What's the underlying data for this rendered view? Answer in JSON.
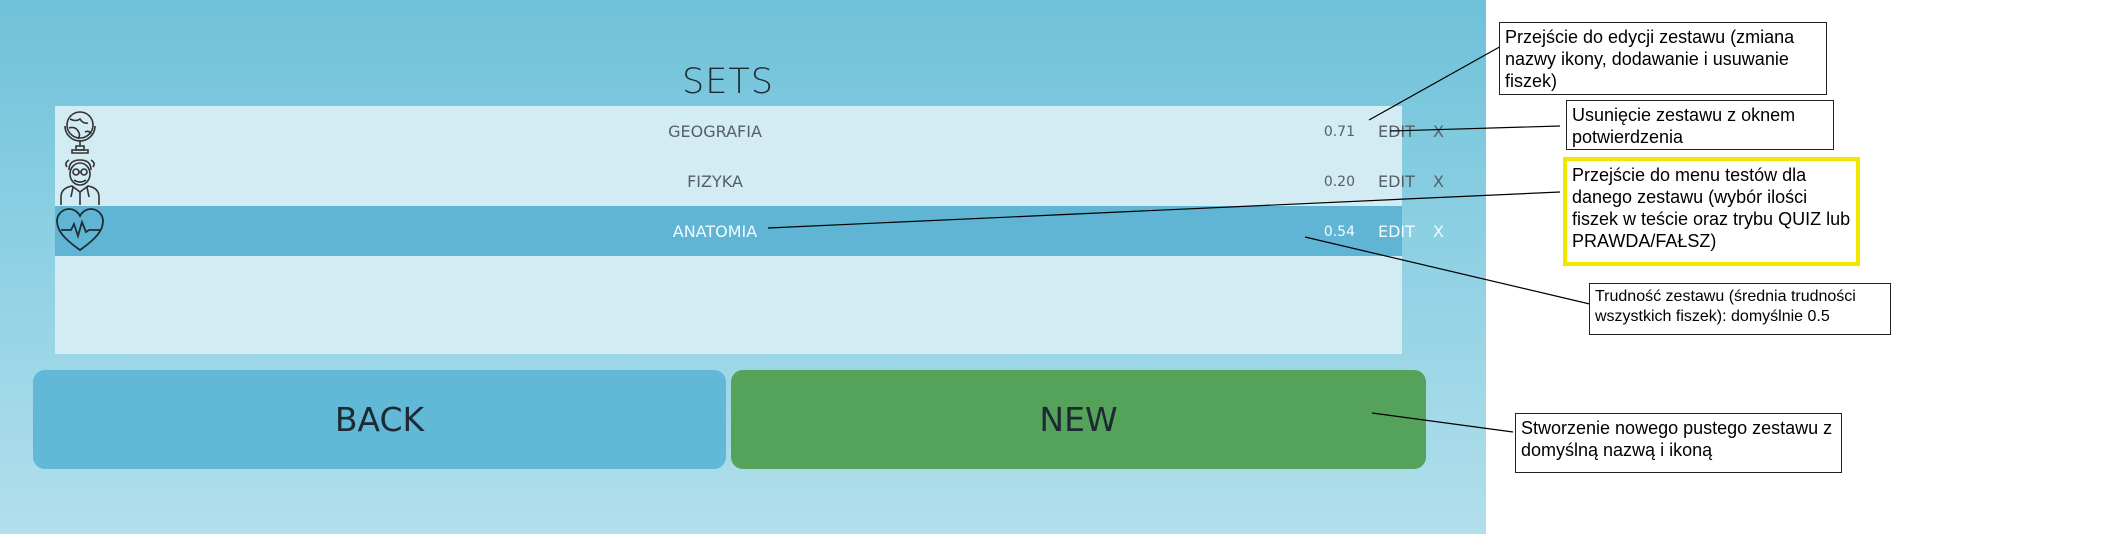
{
  "app": {
    "title": "SETS",
    "sets": [
      {
        "name": "GEOGRAFIA",
        "difficulty": "0.71",
        "edit": "EDIT",
        "delete": "X",
        "icon": "globe-icon",
        "selected": false
      },
      {
        "name": "FIZYKA",
        "difficulty": "0.20",
        "edit": "EDIT",
        "delete": "X",
        "icon": "scientist-icon",
        "selected": false
      },
      {
        "name": "ANATOMIA",
        "difficulty": "0.54",
        "edit": "EDIT",
        "delete": "X",
        "icon": "heartbeat-icon",
        "selected": true
      }
    ],
    "buttons": {
      "back": "BACK",
      "new": "NEW"
    },
    "colors": {
      "background": "#8dd0e3",
      "list": "#d3ecf3",
      "selected_row": "#5fb5d3",
      "back_button": "#61b9d7",
      "new_button": "#55a25b",
      "highlight": "#f5e600"
    }
  },
  "annotations": {
    "edit": "Przejście do edycji zestawu (zmiana nazwy ikony, dodawanie i usuwanie fiszek)",
    "delete": "Usunięcie zestawu z oknem potwierdzenia",
    "tests": "Przejście do menu testów dla danego zestawu (wybór ilości fiszek w teście oraz trybu QUIZ lub PRAWDA/FAŁSZ)",
    "difficulty": "Trudność zestawu (średnia trudności wszystkich fiszek): domyślnie 0.5",
    "new": "Stworzenie nowego pustego zestawu z domyślną nazwą i ikoną"
  }
}
